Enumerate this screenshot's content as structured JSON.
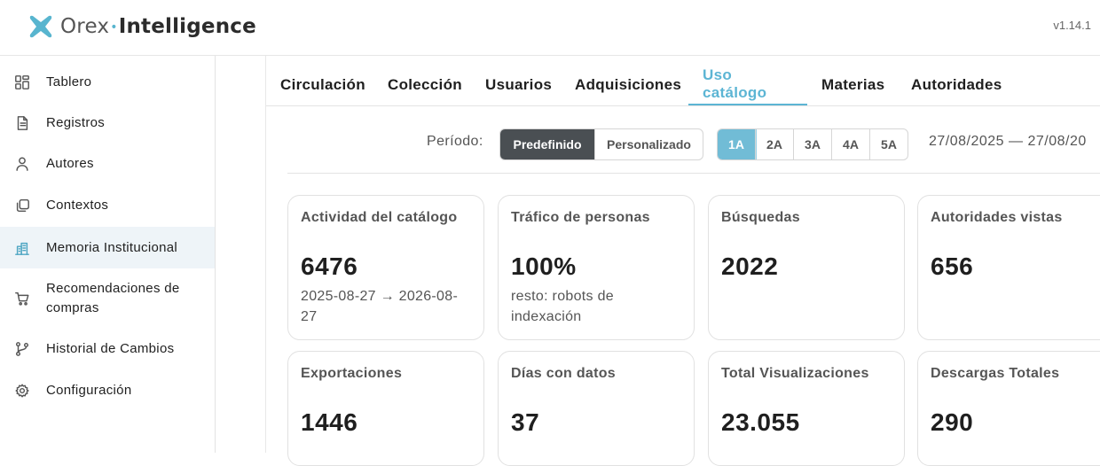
{
  "header": {
    "logo_part1": "Orex",
    "logo_sep": "•",
    "logo_part2": "Intelligence",
    "version": "v1.14.1",
    "brand_color": "#58b5cf"
  },
  "sidebar": {
    "items": [
      {
        "label": "Tablero",
        "icon": "dashboard-icon"
      },
      {
        "label": "Registros",
        "icon": "document-icon"
      },
      {
        "label": "Autores",
        "icon": "user-icon"
      },
      {
        "label": "Contextos",
        "icon": "copy-icon"
      },
      {
        "label": "Memoria Institucional",
        "icon": "building-icon",
        "active": true
      },
      {
        "label": "Recomendaciones de compras",
        "icon": "cart-icon"
      },
      {
        "label": "Historial de Cambios",
        "icon": "git-branch-icon"
      },
      {
        "label": "Configuración",
        "icon": "gear-icon"
      }
    ]
  },
  "tabs": [
    {
      "label": "Circulación"
    },
    {
      "label": "Colección"
    },
    {
      "label": "Usuarios"
    },
    {
      "label": "Adquisiciones"
    },
    {
      "label": "Uso catálogo",
      "active": true
    },
    {
      "label": "Materias"
    },
    {
      "label": "Autoridades"
    }
  ],
  "period": {
    "label": "Período:",
    "modes": [
      "Predefinido",
      "Personalizado"
    ],
    "selected_mode": "Predefinido",
    "ranges": [
      "1A",
      "2A",
      "3A",
      "4A",
      "5A"
    ],
    "selected_range": "1A",
    "date_range": "27/08/2025 — 27/08/20"
  },
  "cards": [
    {
      "title": "Actividad del catálogo",
      "value": "6476",
      "sub": "2025-08-27 → 2026-08-27"
    },
    {
      "title": "Tráfico de personas",
      "value": "100%",
      "sub": "resto: robots de indexación"
    },
    {
      "title": "Búsquedas",
      "value": "2022",
      "sub": ""
    },
    {
      "title": "Autoridades vistas",
      "value": "656",
      "sub": ""
    },
    {
      "title": "Exportaciones",
      "value": "1446",
      "sub": ""
    },
    {
      "title": "Días con datos",
      "value": "37",
      "sub": ""
    },
    {
      "title": "Total Visualizaciones",
      "value": "23.055",
      "sub": ""
    },
    {
      "title": "Descargas Totales",
      "value": "290",
      "sub": ""
    }
  ],
  "colors": {
    "accent": "#5cb5d4",
    "active_bg": "#eef4f8",
    "dark_button": "#4a4f53"
  }
}
